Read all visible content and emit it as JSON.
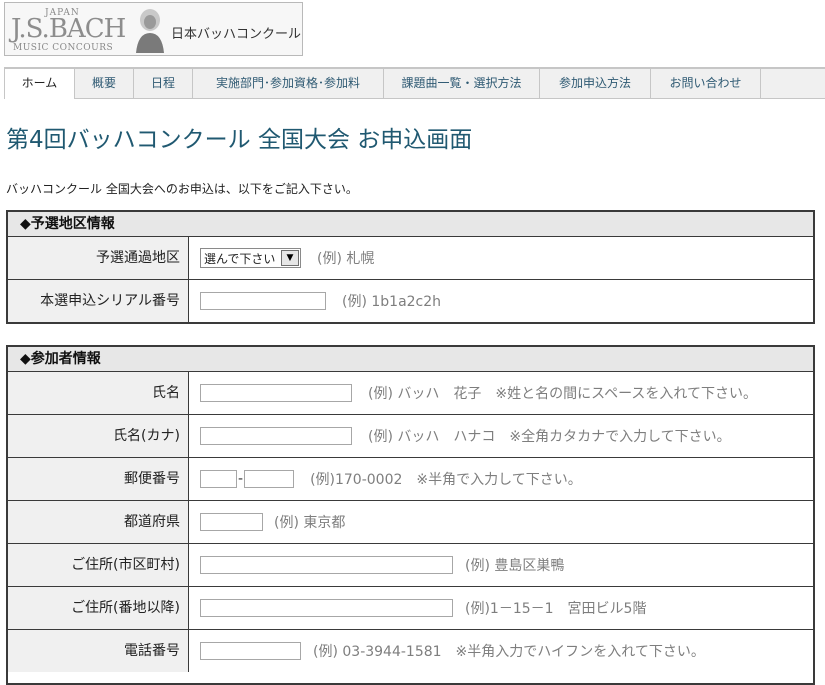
{
  "logo": {
    "japan": "JAPAN",
    "jsbach": "J.S.BACH",
    "music": "MUSIC CONCOURS",
    "jp_name": "日本バッハコンクール"
  },
  "nav": {
    "tabs": [
      {
        "label": "ホーム"
      },
      {
        "label": "概要"
      },
      {
        "label": "日程"
      },
      {
        "label": "実施部門･参加資格･参加料"
      },
      {
        "label": "課題曲一覧・選択方法"
      },
      {
        "label": "参加申込方法"
      },
      {
        "label": "お問い合わせ"
      }
    ]
  },
  "page": {
    "title": "第4回バッハコンクール 全国大会 お申込画面",
    "intro": "バッハコンクール 全国大会へのお申込は、以下をご記入下さい。"
  },
  "sections": [
    {
      "heading": "◆予選地区情報",
      "rows": [
        {
          "label": "予選通過地区",
          "select_value": "選んで下さい",
          "hint": "(例) 札幌"
        },
        {
          "label": "本選申込シリアル番号",
          "value": "",
          "hint": "(例) 1b1a2c2h"
        }
      ]
    },
    {
      "heading": "◆参加者情報",
      "rows": [
        {
          "label": "氏名",
          "value": "",
          "hint": "(例) バッハ　花子　※姓と名の間にスペースを入れて下さい。"
        },
        {
          "label": "氏名(カナ)",
          "value": "",
          "hint": "(例) バッハ　ハナコ　※全角カタカナで入力して下さい。"
        },
        {
          "label": "郵便番号",
          "value1": "",
          "value2": "",
          "separator": "-",
          "hint": "(例)170-0002　※半角で入力して下さい。"
        },
        {
          "label": "都道府県",
          "value": "",
          "hint": "(例) 東京都"
        },
        {
          "label": "ご住所(市区町村)",
          "value": "",
          "hint": "(例) 豊島区巣鴨"
        },
        {
          "label": "ご住所(番地以降)",
          "value": "",
          "hint": "(例)1－15－1　宮田ビル5階"
        },
        {
          "label": "電話番号",
          "value": "",
          "hint": "(例) 03-3944-1581　※半角入力でハイフンを入れて下さい。"
        }
      ]
    }
  ]
}
